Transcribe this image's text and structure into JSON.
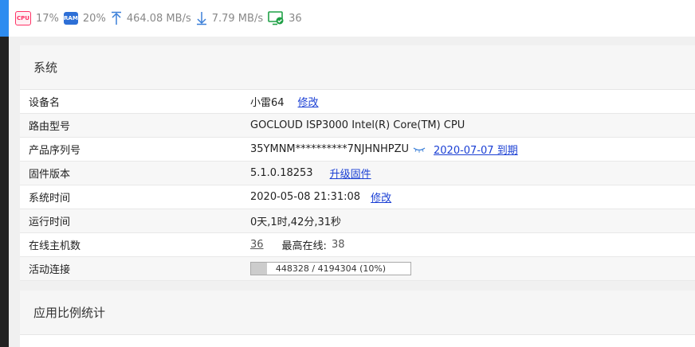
{
  "status": {
    "cpu_badge": "CPU",
    "cpu": "17%",
    "ram_badge": "RAM",
    "ram": "20%",
    "upload": "464.08 MB/s",
    "download": "7.79 MB/s",
    "online": "36"
  },
  "system": {
    "title": "系统",
    "rows": [
      {
        "label": "设备名",
        "value": "小雷64",
        "link": "修改"
      },
      {
        "label": "路由型号",
        "value": "GOCLOUD ISP3000 Intel(R) Core(TM) CPU"
      },
      {
        "label": "产品序列号",
        "value": "35YMNM**********7NJHNHPZU",
        "link": "2020-07-07 到期"
      },
      {
        "label": "固件版本",
        "value": "5.1.0.18253",
        "link": "升级固件"
      },
      {
        "label": "系统时间",
        "value": "2020-05-08 21:31:08",
        "link": "修改"
      },
      {
        "label": "运行时间",
        "value": "0天,1时,42分,31秒"
      },
      {
        "label": "在线主机数",
        "value": "36",
        "extra_label": "最高在线:",
        "extra_value": "38"
      },
      {
        "label": "活动连接",
        "value": "448328 / 4194304 (10%)",
        "fraction": 0.1
      }
    ]
  },
  "app_stats": {
    "title": "应用比例统计"
  },
  "colors": {
    "accent": "#2d8cf0",
    "link": "#1a3fd4"
  }
}
